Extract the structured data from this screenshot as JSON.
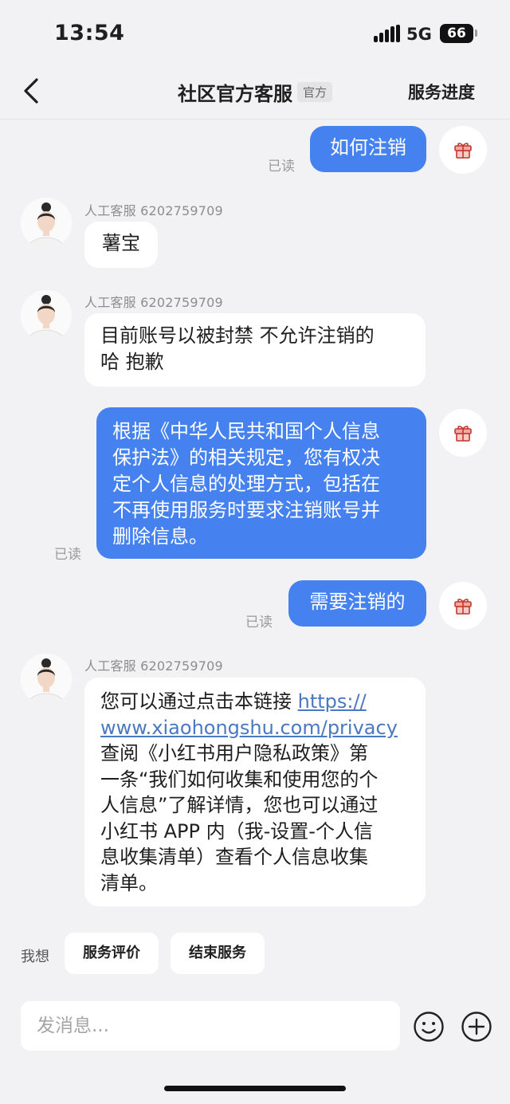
{
  "status_bar": {
    "time": "13:54",
    "network": "5G",
    "battery": "66"
  },
  "nav": {
    "title": "社区官方客服",
    "badge": "官方",
    "right_action": "服务进度",
    "back_icon": "chevron-left-icon"
  },
  "messages": [
    {
      "direction": "out",
      "text": "如何注销",
      "status": "已读"
    },
    {
      "direction": "in",
      "sender": "人工客服 6202759709",
      "text": "薯宝"
    },
    {
      "direction": "in",
      "sender": "人工客服 6202759709",
      "lines": [
        "目前账号以被封禁  不允许注销的",
        "哈 抱歉"
      ]
    },
    {
      "direction": "out",
      "lines": [
        "根据《中华人民共和国个人信息",
        "保护法》的相关规定，您有权决",
        "定个人信息的处理方式，包括在",
        "不再使用服务时要求注销账号并",
        "删除信息。"
      ],
      "status": "已读"
    },
    {
      "direction": "out",
      "text": "需要注销的",
      "status": "已读"
    },
    {
      "direction": "in",
      "sender": "人工客服 6202759709",
      "prefix": "您可以通过点击本链接 ",
      "link_line1": "https://",
      "link_line2": "www.xiaohongshu.com/privacy",
      "lines": [
        "查阅《小红书用户隐私政策》第",
        "一条“我们如何收集和使用您的个",
        "人信息”了解详情，您也可以通过",
        "小红书 APP 内（我-设置-个人信",
        "息收集清单）查看个人信息收集",
        "清单。"
      ]
    }
  ],
  "quick_actions": {
    "label": "我想",
    "items": [
      "服务评价",
      "结束服务"
    ]
  },
  "composer": {
    "placeholder": "发消息...",
    "emoji_icon": "emoji-icon",
    "plus_icon": "plus-icon"
  },
  "colors": {
    "outgoing_bubble": "#4582f0",
    "incoming_bubble": "#ffffff",
    "background": "#f2f2f4",
    "link": "#4a78c2"
  }
}
